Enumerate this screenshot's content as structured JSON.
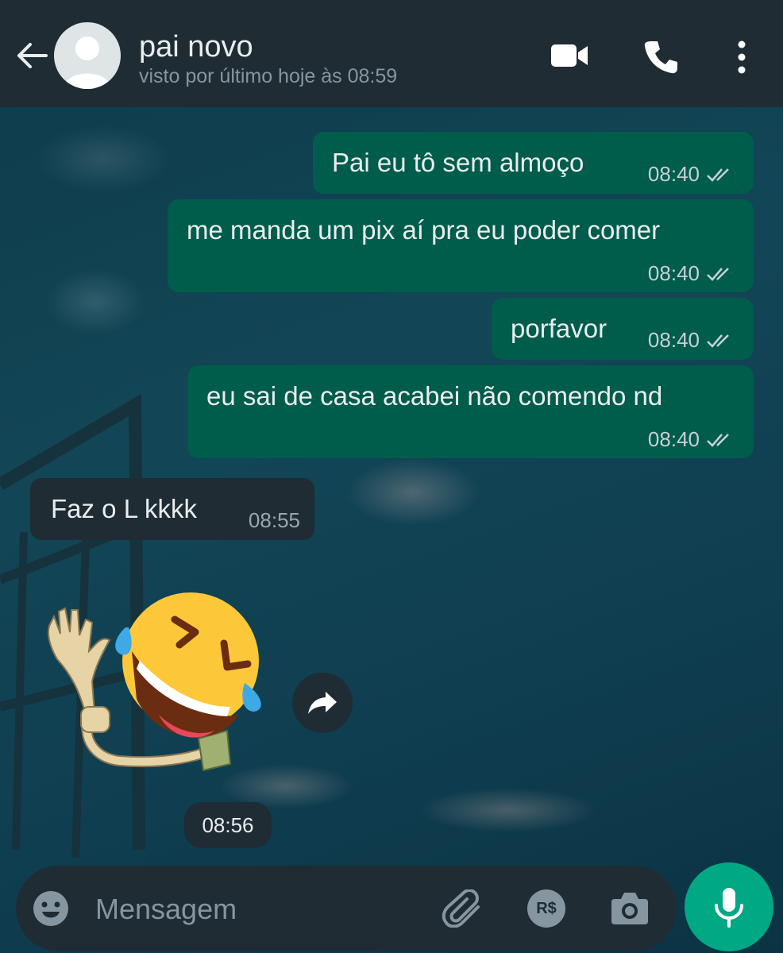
{
  "header": {
    "contact_name": "pai novo",
    "last_seen": "visto por último hoje às 08:59",
    "icons": [
      "back-arrow-icon",
      "avatar",
      "video-call-icon",
      "phone-icon",
      "more-options-icon"
    ]
  },
  "messages": [
    {
      "direction": "outgoing",
      "text": "Pai eu tô sem almoço",
      "time": "08:40",
      "status": "read"
    },
    {
      "direction": "outgoing",
      "text": "me manda um pix aí pra eu poder comer",
      "time": "08:40",
      "status": "read"
    },
    {
      "direction": "outgoing",
      "text": "porfavor",
      "time": "08:40",
      "status": "read"
    },
    {
      "direction": "outgoing",
      "text": "eu sai de casa acabei não comendo nd",
      "time": "08:40",
      "status": "read"
    },
    {
      "direction": "incoming",
      "text": "Faz o L kkkk",
      "time": "08:55"
    },
    {
      "direction": "incoming",
      "type": "sticker",
      "sticker": "laughing-emoji-waving-hand-sticker",
      "time": "08:56"
    }
  ],
  "composer": {
    "placeholder": "Mensagem",
    "icons": [
      "emoji-icon",
      "attach-icon",
      "pix-payment-icon",
      "camera-icon",
      "mic-icon"
    ],
    "pix_label": "R$"
  },
  "colors": {
    "header_bg": "#1f2c34",
    "outgoing_bubble": "#005c4b",
    "incoming_bubble": "#1f2c34",
    "accent": "#00a884",
    "read_ticks": "#c5d1d6"
  }
}
